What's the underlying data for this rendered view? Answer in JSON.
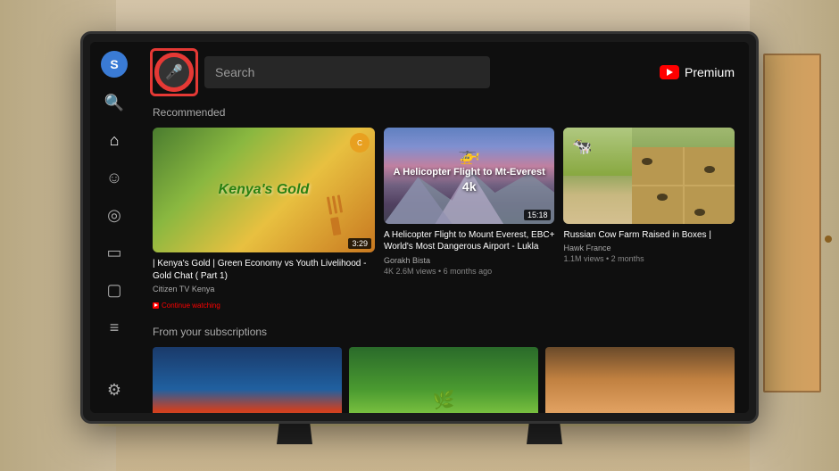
{
  "room": {
    "bg_color": "#c8b89a"
  },
  "sidebar": {
    "avatar_letter": "S",
    "items": [
      {
        "name": "search",
        "icon": "🔍"
      },
      {
        "name": "home",
        "icon": "🏠"
      },
      {
        "name": "subscriptions",
        "icon": "😊"
      },
      {
        "name": "explore",
        "icon": "🎯"
      },
      {
        "name": "library",
        "icon": "📋"
      },
      {
        "name": "history",
        "icon": "📺"
      },
      {
        "name": "playlist",
        "icon": "☰"
      }
    ],
    "settings_icon": "⚙️"
  },
  "header": {
    "voice_btn_label": "Voice Search",
    "search_placeholder": "Search",
    "premium_label": "Premium"
  },
  "recommended": {
    "section_title": "Recommended",
    "videos": [
      {
        "id": "kenya-gold",
        "title": "| Kenya's Gold | Green Economy vs Youth Livelihood - Gold Chat ( Part 1)",
        "channel": "Citizen TV Kenya",
        "meta": "",
        "continue_watching": "Continue watching",
        "duration": "3:29",
        "thumb_text": "Kenya's Gold"
      },
      {
        "id": "helicopter",
        "title": "A Helicopter Flight to Mount Everest, EBC+ World's Most Dangerous Airport - Lukla",
        "channel": "Gorakh Bista",
        "meta": "4K  2.6M views • 6 months ago",
        "duration": "15:18",
        "thumb_main": "A Helicopter Flight to Mt-Everest",
        "thumb_sub": "4k"
      },
      {
        "id": "russian-cow",
        "title": "Russian Cow Farm Raised in Boxes |",
        "channel": "Hawk France",
        "meta": "1.1M views • 2 months",
        "duration": ""
      }
    ]
  },
  "subscriptions": {
    "section_title": "From your subscriptions",
    "items": [
      {
        "id": "sub1",
        "color": "#1a3a6a"
      },
      {
        "id": "sub2",
        "color": "#2a6a2a"
      },
      {
        "id": "sub3",
        "color": "#6a4a2a"
      }
    ]
  }
}
